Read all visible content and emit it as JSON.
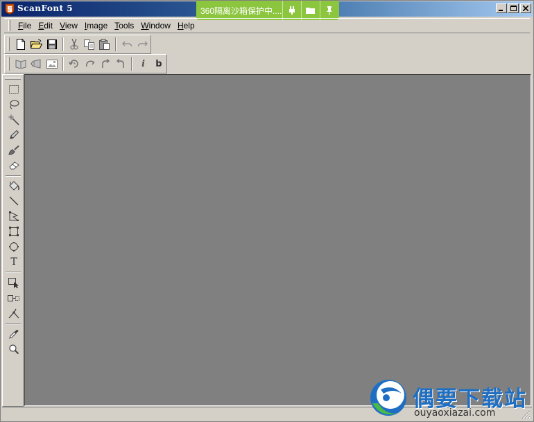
{
  "window": {
    "title": "ScanFont 5"
  },
  "sandbox": {
    "text": "360隔离沙箱保护中....",
    "color": "#8cc63f"
  },
  "menu": {
    "items": [
      {
        "label": "File",
        "mnemonic": "F"
      },
      {
        "label": "Edit",
        "mnemonic": "E"
      },
      {
        "label": "View",
        "mnemonic": "V"
      },
      {
        "label": "Image",
        "mnemonic": "I"
      },
      {
        "label": "Tools",
        "mnemonic": "T"
      },
      {
        "label": "Window",
        "mnemonic": "W"
      },
      {
        "label": "Help",
        "mnemonic": "H"
      }
    ]
  },
  "toolbar_main": {
    "icons": [
      "new-document-icon",
      "open-folder-icon",
      "save-icon",
      "cut-icon",
      "copy-icon",
      "paste-icon",
      "undo-icon",
      "redo-icon"
    ]
  },
  "toolbar_image": {
    "icons": [
      "book-icon",
      "shear-icon",
      "image-icon",
      "rotate-icon",
      "rotate-ccw-icon",
      "rotate-cw-icon",
      "flip-icon"
    ],
    "italic_label": "i",
    "bold_label": "b"
  },
  "tools": {
    "icons": [
      "rect-select-icon",
      "lasso-icon",
      "magic-wand-icon",
      "pencil-icon",
      "brush-icon",
      "eraser-icon",
      "fill-bucket-icon",
      "line-icon",
      "polygon-icon",
      "rectangle-icon",
      "ellipse-icon",
      "text-tool-icon",
      "move-select-icon",
      "transform-icon",
      "node-edit-icon",
      "eyedropper-icon",
      "zoom-icon"
    ],
    "text_tool_label": "T"
  },
  "watermark": {
    "title": "偶要下载站",
    "url": "ouyaoxiazai.com",
    "color": "#1e6fc4"
  },
  "colors": {
    "chrome": "#d4d0c8",
    "workspace": "#808080",
    "titlebar_start": "#0a246a",
    "titlebar_end": "#a6caf0"
  }
}
